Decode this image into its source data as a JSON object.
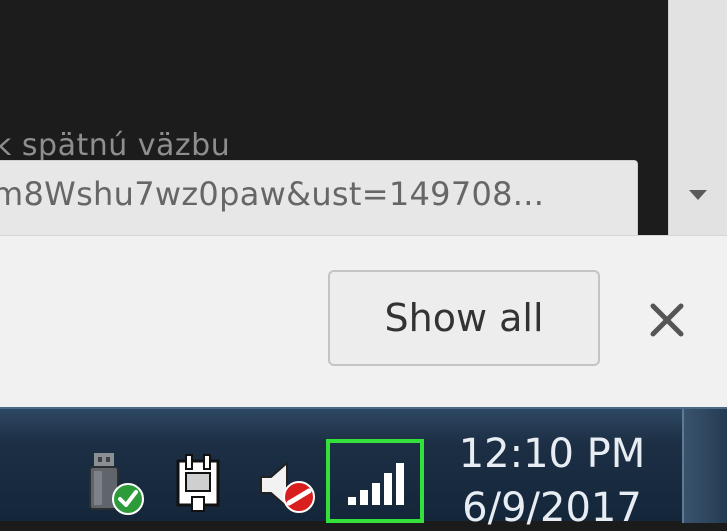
{
  "content": {
    "partial_text": "k spätnú väzbu",
    "url_tooltip": "m8Wshu7wz0paw&ust=149708..."
  },
  "download_bar": {
    "show_all_label": "Show all",
    "close_icon": "close-icon"
  },
  "taskbar": {
    "tray_icons": [
      "usb-device-icon",
      "power-plug-icon",
      "speaker-muted-icon",
      "wifi-signal-icon"
    ],
    "highlight_color": "#34e03a",
    "clock": {
      "time": "12:10 PM",
      "date": "6/9/2017"
    }
  }
}
